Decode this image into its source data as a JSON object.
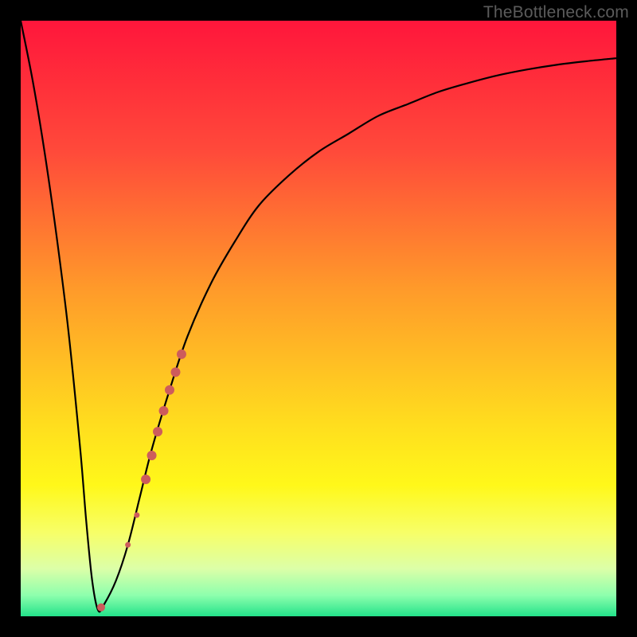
{
  "watermark": "TheBottleneck.com",
  "colors": {
    "frame": "#000000",
    "curve": "#000000",
    "dots": "#cd5c5c",
    "gradient_stops": [
      {
        "offset": 0.0,
        "color": "#ff163b"
      },
      {
        "offset": 0.22,
        "color": "#ff4a3a"
      },
      {
        "offset": 0.45,
        "color": "#ff9a2a"
      },
      {
        "offset": 0.68,
        "color": "#ffde1e"
      },
      {
        "offset": 0.78,
        "color": "#fff81a"
      },
      {
        "offset": 0.86,
        "color": "#f7ff68"
      },
      {
        "offset": 0.92,
        "color": "#dcffa8"
      },
      {
        "offset": 0.965,
        "color": "#8dffad"
      },
      {
        "offset": 1.0,
        "color": "#23e28a"
      }
    ]
  },
  "chart_data": {
    "type": "line",
    "title": "",
    "xlabel": "",
    "ylabel": "",
    "xlim": [
      0,
      100
    ],
    "ylim": [
      0,
      100
    ],
    "grid": false,
    "legend": false,
    "series": [
      {
        "name": "bottleneck-curve",
        "x": [
          0,
          2,
          4,
          6,
          8,
          10,
          11,
          12,
          13,
          14,
          16,
          18,
          20,
          22,
          25,
          28,
          32,
          36,
          40,
          45,
          50,
          55,
          60,
          65,
          70,
          75,
          80,
          85,
          90,
          95,
          100
        ],
        "y": [
          100,
          90,
          78,
          64,
          48,
          28,
          16,
          6,
          1,
          2,
          6,
          12,
          20,
          28,
          38,
          47,
          56,
          63,
          69,
          74,
          78,
          81,
          84,
          86,
          88,
          89.5,
          90.8,
          91.8,
          92.6,
          93.2,
          93.7
        ]
      }
    ],
    "points": [
      {
        "x": 13.5,
        "y": 1.5,
        "r": 5
      },
      {
        "x": 18.0,
        "y": 12.0,
        "r": 3.5
      },
      {
        "x": 19.5,
        "y": 17.0,
        "r": 3.5
      },
      {
        "x": 21.0,
        "y": 23.0,
        "r": 6
      },
      {
        "x": 22.0,
        "y": 27.0,
        "r": 6
      },
      {
        "x": 23.0,
        "y": 31.0,
        "r": 6
      },
      {
        "x": 24.0,
        "y": 34.5,
        "r": 6
      },
      {
        "x": 25.0,
        "y": 38.0,
        "r": 6
      },
      {
        "x": 26.0,
        "y": 41.0,
        "r": 6
      },
      {
        "x": 27.0,
        "y": 44.0,
        "r": 6
      }
    ]
  }
}
